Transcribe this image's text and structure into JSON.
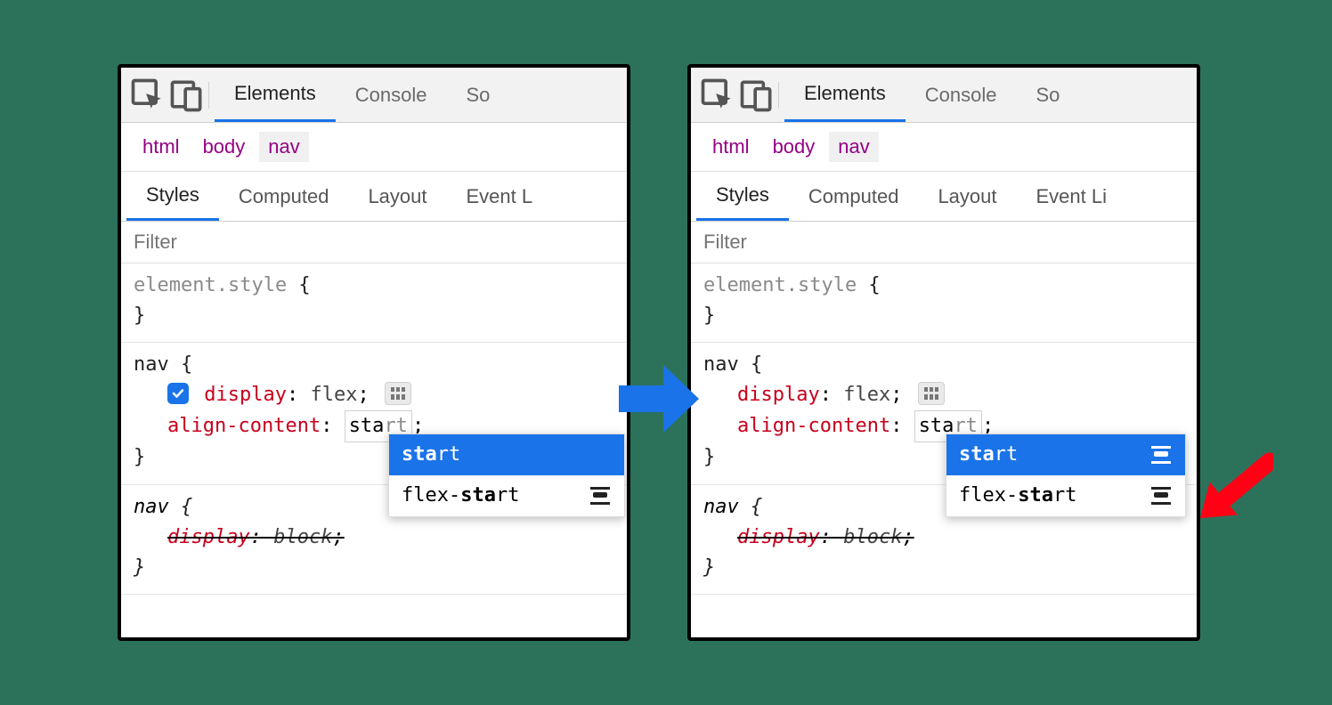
{
  "main_tabs": {
    "elements": "Elements",
    "console": "Console",
    "sources_partial": "So"
  },
  "breadcrumbs": [
    "html",
    "body",
    "nav"
  ],
  "sub_tabs": {
    "styles": "Styles",
    "computed": "Computed",
    "layout": "Layout",
    "event_partial_left": "Event L",
    "event_partial_right": "Event Li"
  },
  "filter_placeholder": "Filter",
  "rules": {
    "element_style": {
      "selector": "element.style",
      "open": " {",
      "close": "}"
    },
    "nav_rule": {
      "selector": "nav",
      "open": " {",
      "close": "}",
      "display_prop": "display",
      "display_val": "flex",
      "align_prop": "align-content",
      "align_val": "start",
      "semicolon": ";",
      "colon": ":"
    },
    "overridden": {
      "selector": "nav",
      "open": " {",
      "close": "}",
      "prop": "display",
      "val": "block"
    }
  },
  "autocomplete": {
    "typed": "sta",
    "rest": "rt",
    "item1_bold": "sta",
    "item1_rest": "rt",
    "item2_pre": "flex-",
    "item2_bold": "sta",
    "item2_rest": "rt"
  },
  "colors": {
    "accent": "#1a73e8",
    "prop": "#c8001c",
    "crumb": "#940084",
    "red_arrow": "#ff0015",
    "bg": "#2c725b"
  }
}
